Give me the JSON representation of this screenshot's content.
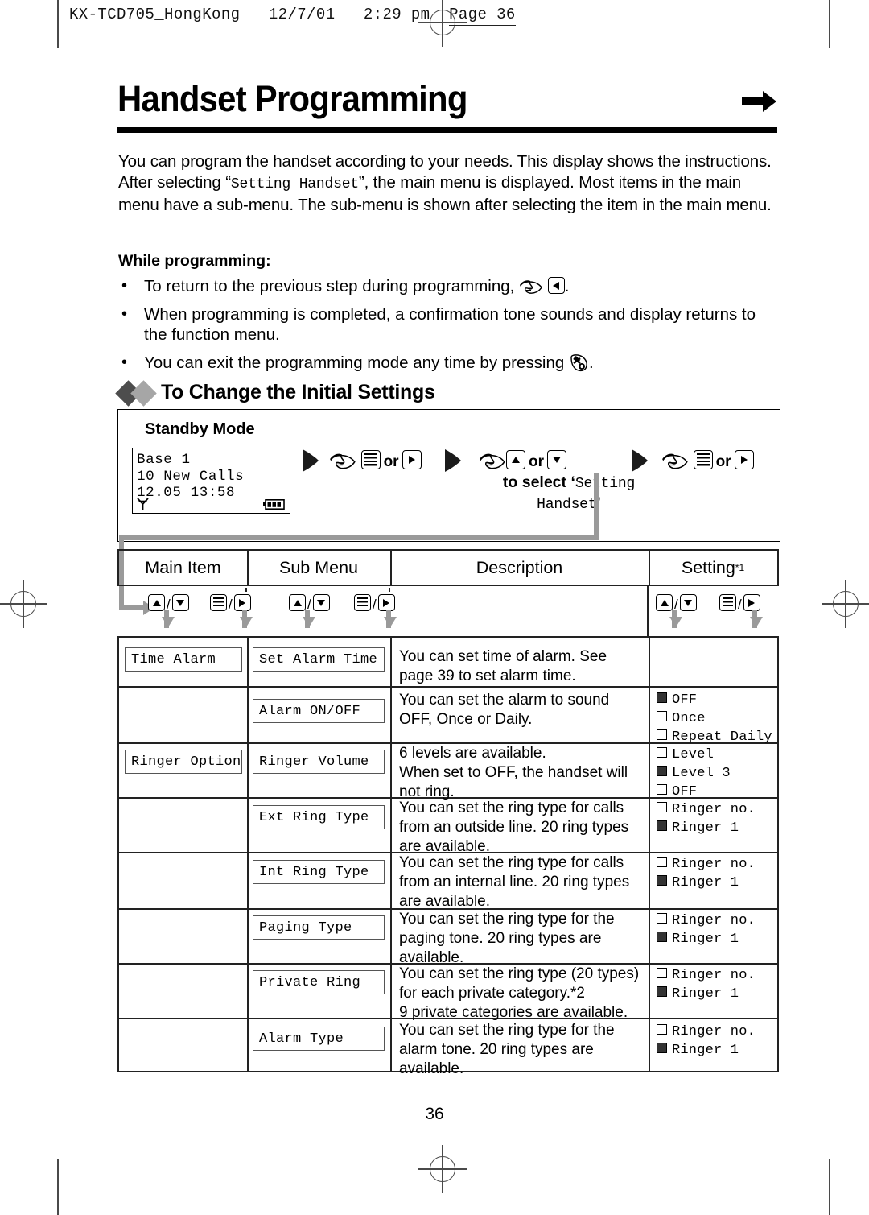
{
  "running_header": {
    "text": "KX-TCD705_HongKong   12/7/01   2:29 pm",
    "page_label": "Page 36"
  },
  "title": "Handset Programming",
  "title_arrow_icon": "right-arrow-icon",
  "intro": {
    "part1": "You can program the handset according to your needs. This display shows the instructions. After selecting “",
    "mono": "Setting Handset",
    "part2": "”, the main menu is displayed. Most items in the main menu have a sub-menu. The sub-menu is shown after selecting the item in the main menu."
  },
  "while_programming": {
    "heading": "While programming:",
    "bullets": [
      {
        "before": "To return to the previous step during programming,",
        "icons": [
          "hand-pointer-icon",
          "left-arrow-key-icon"
        ],
        "after": "."
      },
      {
        "before": "When programming is completed, a confirmation tone sounds and display returns to the function menu.",
        "icons": [],
        "after": ""
      },
      {
        "before": "You can exit the programming mode any time by pressing",
        "icons": [
          "power-off-key-icon"
        ],
        "after": "."
      }
    ]
  },
  "section_heading": "To Change the Initial Settings",
  "standby": {
    "title": "Standby Mode",
    "lcd": {
      "line1": "Base 1",
      "line2": "10 New Calls",
      "line3": " 12.05 13:58",
      "antenna_icon": "antenna-icon",
      "battery_icon": "battery-full-icon"
    },
    "steps": [
      {
        "keys": [
          "menu-key-icon",
          "right-arrow-key-icon"
        ],
        "or": "or",
        "caption": ""
      },
      {
        "keys": [
          "up-arrow-key-icon",
          "down-arrow-key-icon"
        ],
        "or": "or",
        "caption_prefix": "to select ‘",
        "caption_mono": "Setting Handset",
        "caption_suffix": "’"
      },
      {
        "keys": [
          "menu-key-icon",
          "right-arrow-key-icon"
        ],
        "or": "or",
        "caption": ""
      }
    ]
  },
  "table": {
    "headers": [
      {
        "label": "Main Item",
        "sup": ""
      },
      {
        "label": "Sub Menu",
        "sup": ""
      },
      {
        "label": "Description",
        "sup": ""
      },
      {
        "label": "Setting",
        "sup": "*1"
      }
    ],
    "key_row": {
      "groups": [
        {
          "keys": [
            "up-arrow-key-icon",
            "down-arrow-key-icon"
          ],
          "sep": "/"
        },
        {
          "keys": [
            "menu-key-icon",
            "right-arrow-key-icon"
          ],
          "sep": "/"
        },
        {
          "keys": [
            "up-arrow-key-icon",
            "down-arrow-key-icon"
          ],
          "sep": "/"
        },
        {
          "keys": [
            "menu-key-icon",
            "right-arrow-key-icon"
          ],
          "sep": "/"
        },
        {
          "keys": [
            "up-arrow-key-icon",
            "down-arrow-key-icon"
          ],
          "sep": "/"
        },
        {
          "keys": [
            "menu-key-icon",
            "right-arrow-key-icon"
          ],
          "sep": "/"
        }
      ]
    },
    "rows": [
      {
        "main_item": "Time Alarm",
        "sub_menu": "Set Alarm Time",
        "description": "You can set time of alarm. See page 39 to set alarm time.",
        "settings": []
      },
      {
        "main_item": "",
        "sub_menu": "Alarm ON/OFF",
        "description": "You can set the alarm to sound OFF, Once or Daily.",
        "settings": [
          {
            "label": "OFF",
            "checked": true
          },
          {
            "label": "Once",
            "checked": false
          },
          {
            "label": "Repeat Daily",
            "checked": false
          }
        ]
      },
      {
        "main_item": "Ringer Option",
        "sub_menu": "Ringer Volume",
        "description": "6 levels are available.\nWhen set to OFF, the handset will not ring.",
        "settings": [
          {
            "label": "Level",
            "checked": false
          },
          {
            "label": "Level 3",
            "checked": true
          },
          {
            "label": "OFF",
            "checked": false
          }
        ]
      },
      {
        "main_item": "",
        "sub_menu": "Ext Ring Type",
        "description": "You can set the ring type for calls from an outside line. 20 ring types are available.",
        "settings": [
          {
            "label": "Ringer no.",
            "checked": false
          },
          {
            "label": "Ringer 1",
            "checked": true
          }
        ]
      },
      {
        "main_item": "",
        "sub_menu": "Int Ring Type",
        "description": "You can set the ring type for calls from an internal line. 20 ring types are available.",
        "settings": [
          {
            "label": "Ringer no.",
            "checked": false
          },
          {
            "label": "Ringer 1",
            "checked": true
          }
        ]
      },
      {
        "main_item": "",
        "sub_menu": "Paging Type",
        "description": "You can set the ring type  for the paging tone. 20 ring types are available.",
        "settings": [
          {
            "label": "Ringer no.",
            "checked": false
          },
          {
            "label": "Ringer 1",
            "checked": true
          }
        ]
      },
      {
        "main_item": "",
        "sub_menu": "Private Ring",
        "description": "You can set the ring type (20 types) for each private category.*2\n9 private categories are available.",
        "settings": [
          {
            "label": "Ringer no.",
            "checked": false
          },
          {
            "label": "Ringer 1",
            "checked": true
          }
        ]
      },
      {
        "main_item": "",
        "sub_menu": "Alarm Type",
        "description": "You can set the ring type  for the alarm tone. 20 ring types are available.",
        "settings": [
          {
            "label": "Ringer no.",
            "checked": false
          },
          {
            "label": "Ringer 1",
            "checked": true
          }
        ]
      }
    ]
  },
  "page_number": "36"
}
